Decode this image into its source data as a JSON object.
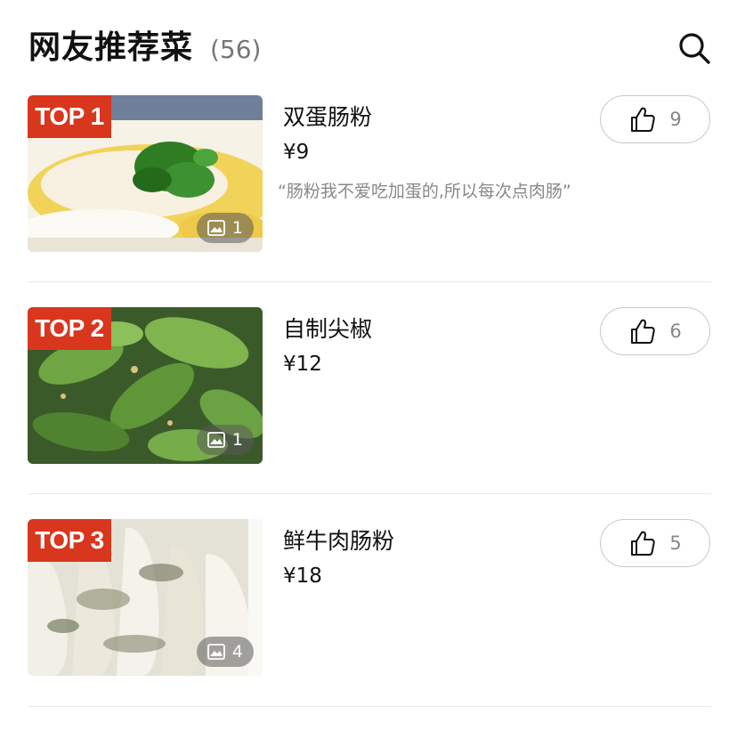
{
  "header": {
    "title": "网友推荐菜",
    "count": "(56)",
    "search_icon": "search-icon"
  },
  "dishes": [
    {
      "badge": "TOP 1",
      "name": "双蛋肠粉",
      "price": "¥9",
      "quote": "“肠粉我不爱吃加蛋的,所以每次点肉肠”",
      "image_count": "1",
      "likes": "9"
    },
    {
      "badge": "TOP 2",
      "name": "自制尖椒",
      "price": "¥12",
      "quote": "",
      "image_count": "1",
      "likes": "6"
    },
    {
      "badge": "TOP 3",
      "name": "鲜牛肉肠粉",
      "price": "¥18",
      "quote": "",
      "image_count": "4",
      "likes": "5"
    }
  ],
  "colors": {
    "badge": "#d9361e",
    "divider": "#e8e8e8",
    "muted_text": "#888888"
  }
}
